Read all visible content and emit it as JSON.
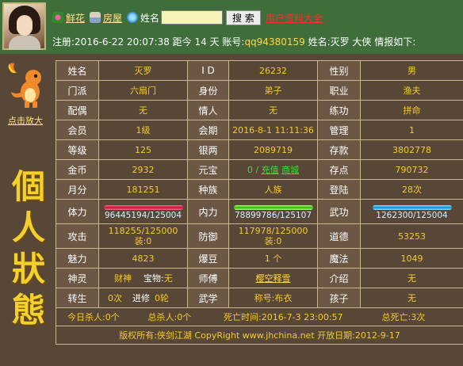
{
  "header": {
    "link_flower": "鲜花",
    "link_house": "房屋",
    "search_label": "姓名",
    "search_value": "",
    "search_button": "搜 索",
    "user_data_link": "用户资料大全",
    "info_line_prefix": "注册:2016-6-22 20:07:38 距今 14 天 账号:",
    "account": "qq94380159",
    "info_line_suffix": " 姓名:灭罗 大侠 情报如下:"
  },
  "pet": {
    "enlarge_link": "点击放大"
  },
  "side_title": [
    "個",
    "人",
    "狀",
    "態"
  ],
  "rows": {
    "r1": {
      "l1": "姓名",
      "v1": "灭罗",
      "l2": "I D",
      "v2": "26232",
      "l3": "性别",
      "v3": "男"
    },
    "r2": {
      "l1": "门派",
      "v1": "六扇门",
      "l2": "身份",
      "v2": "弟子",
      "l3": "职业",
      "v3": "渔夫"
    },
    "r3": {
      "l1": "配偶",
      "v1": "无",
      "l2": "情人",
      "v2": "无",
      "l3": "练功",
      "v3": "拼命"
    },
    "r4": {
      "l1": "会员",
      "v1": "1级",
      "l2": "会期",
      "v2": "2016-8-1 11:11:36",
      "l3": "管理",
      "v3": "1"
    },
    "r5": {
      "l1": "等级",
      "v1": "125",
      "l2": "银两",
      "v2": "2089719",
      "l3": "存款",
      "v3": "3802778"
    },
    "r6": {
      "l1": "金币",
      "v1": "2932",
      "l2": "元宝",
      "v2_num": "0 /",
      "v2_recharge": "充值",
      "v2_shop": "商城",
      "l3": "存点",
      "v3": "790732"
    },
    "r7": {
      "l1": "月分",
      "v1": "181251",
      "l2": "种族",
      "v2": "人族",
      "l3": "登陆",
      "v3": "28次"
    },
    "r8": {
      "l1": "体力",
      "v1": "96445194/125004",
      "l2": "内力",
      "v2": "78899786/125107",
      "l3": "武功",
      "v3": "1262300/125004"
    },
    "r9": {
      "l1": "攻击",
      "v1a": "118255/125000",
      "v1b": "装:0",
      "l2": "防御",
      "v2a": "117978/125000",
      "v2b": "装:0",
      "l3": "道德",
      "v3": "53253"
    },
    "r10": {
      "l1": "魅力",
      "v1": "4823",
      "l2": "爆豆",
      "v2": "1 个",
      "l3": "魔法",
      "v3": "1049"
    },
    "r11": {
      "l1": "神灵",
      "v1": "财神",
      "l1b": "宝物:",
      "v1b": "无",
      "l2": "师傅",
      "v2": "樱空释雪",
      "l3": "介绍",
      "v3": "无"
    },
    "r12": {
      "l1": "转生",
      "v1": "0次",
      "l1b": "进修",
      "v1b": "0轮",
      "l2": "武学",
      "v2": "称号:布衣",
      "l3": "孩子",
      "v3": "无"
    }
  },
  "summary": {
    "today_kills": "今日杀人:0个",
    "total_kills": "总杀人:0个",
    "death_time": "死亡时间:2016-7-3 23:00:57",
    "total_deaths": "总死亡:3次"
  },
  "footer": {
    "text": "版权所有:侠剑江湖 CopyRight www.jhchina.net  开放日期:2012-9-17"
  },
  "colors": {
    "value": "#f2cc2e",
    "header_bg": "#3f6e3a",
    "panel_bg": "#584636"
  }
}
